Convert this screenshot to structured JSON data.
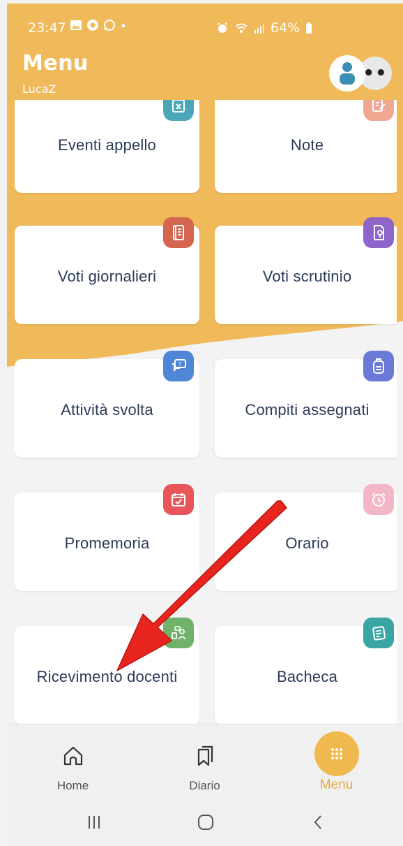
{
  "status_bar": {
    "time": "23:47",
    "left_icons": [
      "image-icon",
      "chrome-icon",
      "whatsapp-icon",
      "dot-icon"
    ],
    "right_icons": [
      "alarm-icon",
      "wifi-icon",
      "signal-icon"
    ],
    "battery": "64%"
  },
  "header": {
    "title": "Menu",
    "user": "LucaZ",
    "more_label": "••"
  },
  "cards": [
    {
      "label": "Eventi appello",
      "icon": "calendar-x-icon",
      "color": "#4aa7b8"
    },
    {
      "label": "Note",
      "icon": "note-edit-icon",
      "color": "#f0a893"
    },
    {
      "label": "Voti giornalieri",
      "icon": "grade-book-icon",
      "color": "#d4654f"
    },
    {
      "label": "Voti scrutinio",
      "icon": "report-icon",
      "color": "#8e65c8"
    },
    {
      "label": "Attività svolta",
      "icon": "chat-question-icon",
      "color": "#4f86d6"
    },
    {
      "label": "Compiti assegnati",
      "icon": "backpack-icon",
      "color": "#6b79d8"
    },
    {
      "label": "Promemoria",
      "icon": "calendar-check-icon",
      "color": "#e8565a"
    },
    {
      "label": "Orario",
      "icon": "alarm-clock-icon",
      "color": "#f2b6c6"
    },
    {
      "label": "Ricevimento docenti",
      "icon": "meeting-icon",
      "color": "#6fb26a"
    },
    {
      "label": "Bacheca",
      "icon": "notice-board-icon",
      "color": "#3aa6a4"
    }
  ],
  "bottom_nav": [
    {
      "label": "Home",
      "icon": "home-icon"
    },
    {
      "label": "Diario",
      "icon": "bookmark-icon"
    },
    {
      "label": "Menu",
      "icon": "grid-dots-icon",
      "active": true
    }
  ],
  "colors": {
    "header_yellow": "#f0b95a",
    "accent": "#e8a93d",
    "card_text": "#2b3a57",
    "arrow_red": "#e8241e"
  }
}
